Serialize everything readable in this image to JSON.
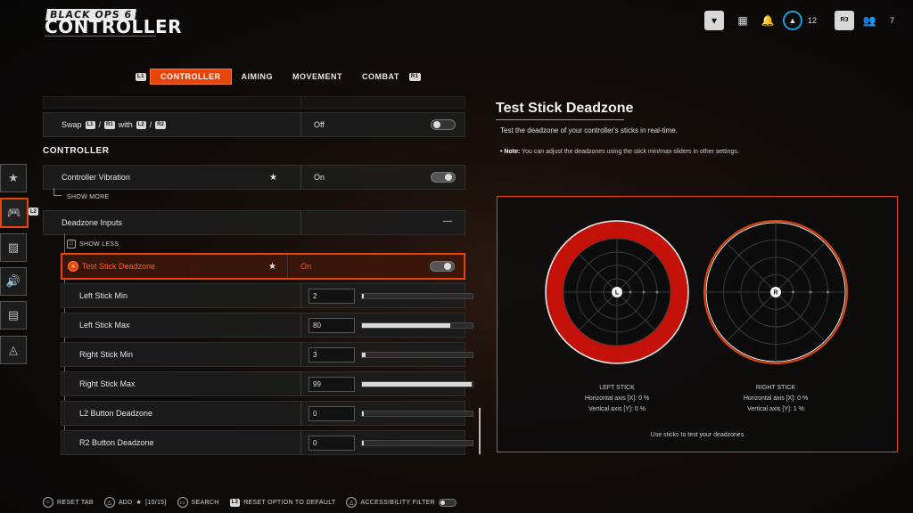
{
  "header": {
    "brand_top": "BLACK OPS 6",
    "brand_main": "CONTROLLER",
    "level": "12",
    "r3_key": "R3",
    "party_count": "7"
  },
  "tabs": {
    "left_key": "L1",
    "right_key": "R1",
    "items": [
      "CONTROLLER",
      "AIMING",
      "MOVEMENT",
      "COMBAT"
    ],
    "active": "CONTROLLER"
  },
  "rail": {
    "l2_key": "L2"
  },
  "list": {
    "swap": {
      "label_swap": "Swap",
      "k1": "L1",
      "k2": "R1",
      "with": "with",
      "k3": "L2",
      "k4": "R2",
      "slash": "/",
      "value": "Off"
    },
    "section_title": "CONTROLLER",
    "vibration": {
      "label": "Controller Vibration",
      "value": "On"
    },
    "show_more": "SHOW MORE",
    "deadzone_inputs": {
      "label": "Deadzone Inputs",
      "value": "—"
    },
    "show_less": "SHOW LESS",
    "test_stick": {
      "label": "Test Stick Deadzone",
      "value": "On"
    },
    "sliders": [
      {
        "label": "Left Stick Min",
        "value": "2",
        "level": 2
      },
      {
        "label": "Left Stick Max",
        "value": "80",
        "level": 80
      },
      {
        "label": "Right Stick Min",
        "value": "3",
        "level": 3
      },
      {
        "label": "Right Stick Max",
        "value": "99",
        "level": 99
      },
      {
        "label": "L2 Button Deadzone",
        "value": "0",
        "level": 0
      },
      {
        "label": "R2 Button Deadzone",
        "value": "0",
        "level": 0
      }
    ]
  },
  "panel": {
    "title": "Test Stick Deadzone",
    "description": "Test the deadzone of your controller's sticks in real-time.",
    "note_label": "Note:",
    "note_text": "You can adjust the deadzones using the stick min/max sliders in other settings.",
    "left": {
      "title": "LEFT STICK",
      "h": "Horizontal axis [X]: 0 %",
      "v": "Vertical axis [Y]: 0 %",
      "center": "L"
    },
    "right": {
      "title": "RIGHT STICK",
      "h": "Horizontal axis [X]: 0 %",
      "v": "Vertical axis [Y]: 1 %",
      "center": "R"
    },
    "footer": "Use sticks to test your deadzones",
    "accent": "#e8440c",
    "left_ring_color": "#c4120a"
  },
  "bottom": {
    "reset_tab": "RESET TAB",
    "add": "ADD",
    "add_count": "[10/15]",
    "search": "SEARCH",
    "l3": "L3",
    "reset_default": "RESET OPTION TO DEFAULT",
    "accessibility": "ACCESSIBILITY FILTER"
  }
}
